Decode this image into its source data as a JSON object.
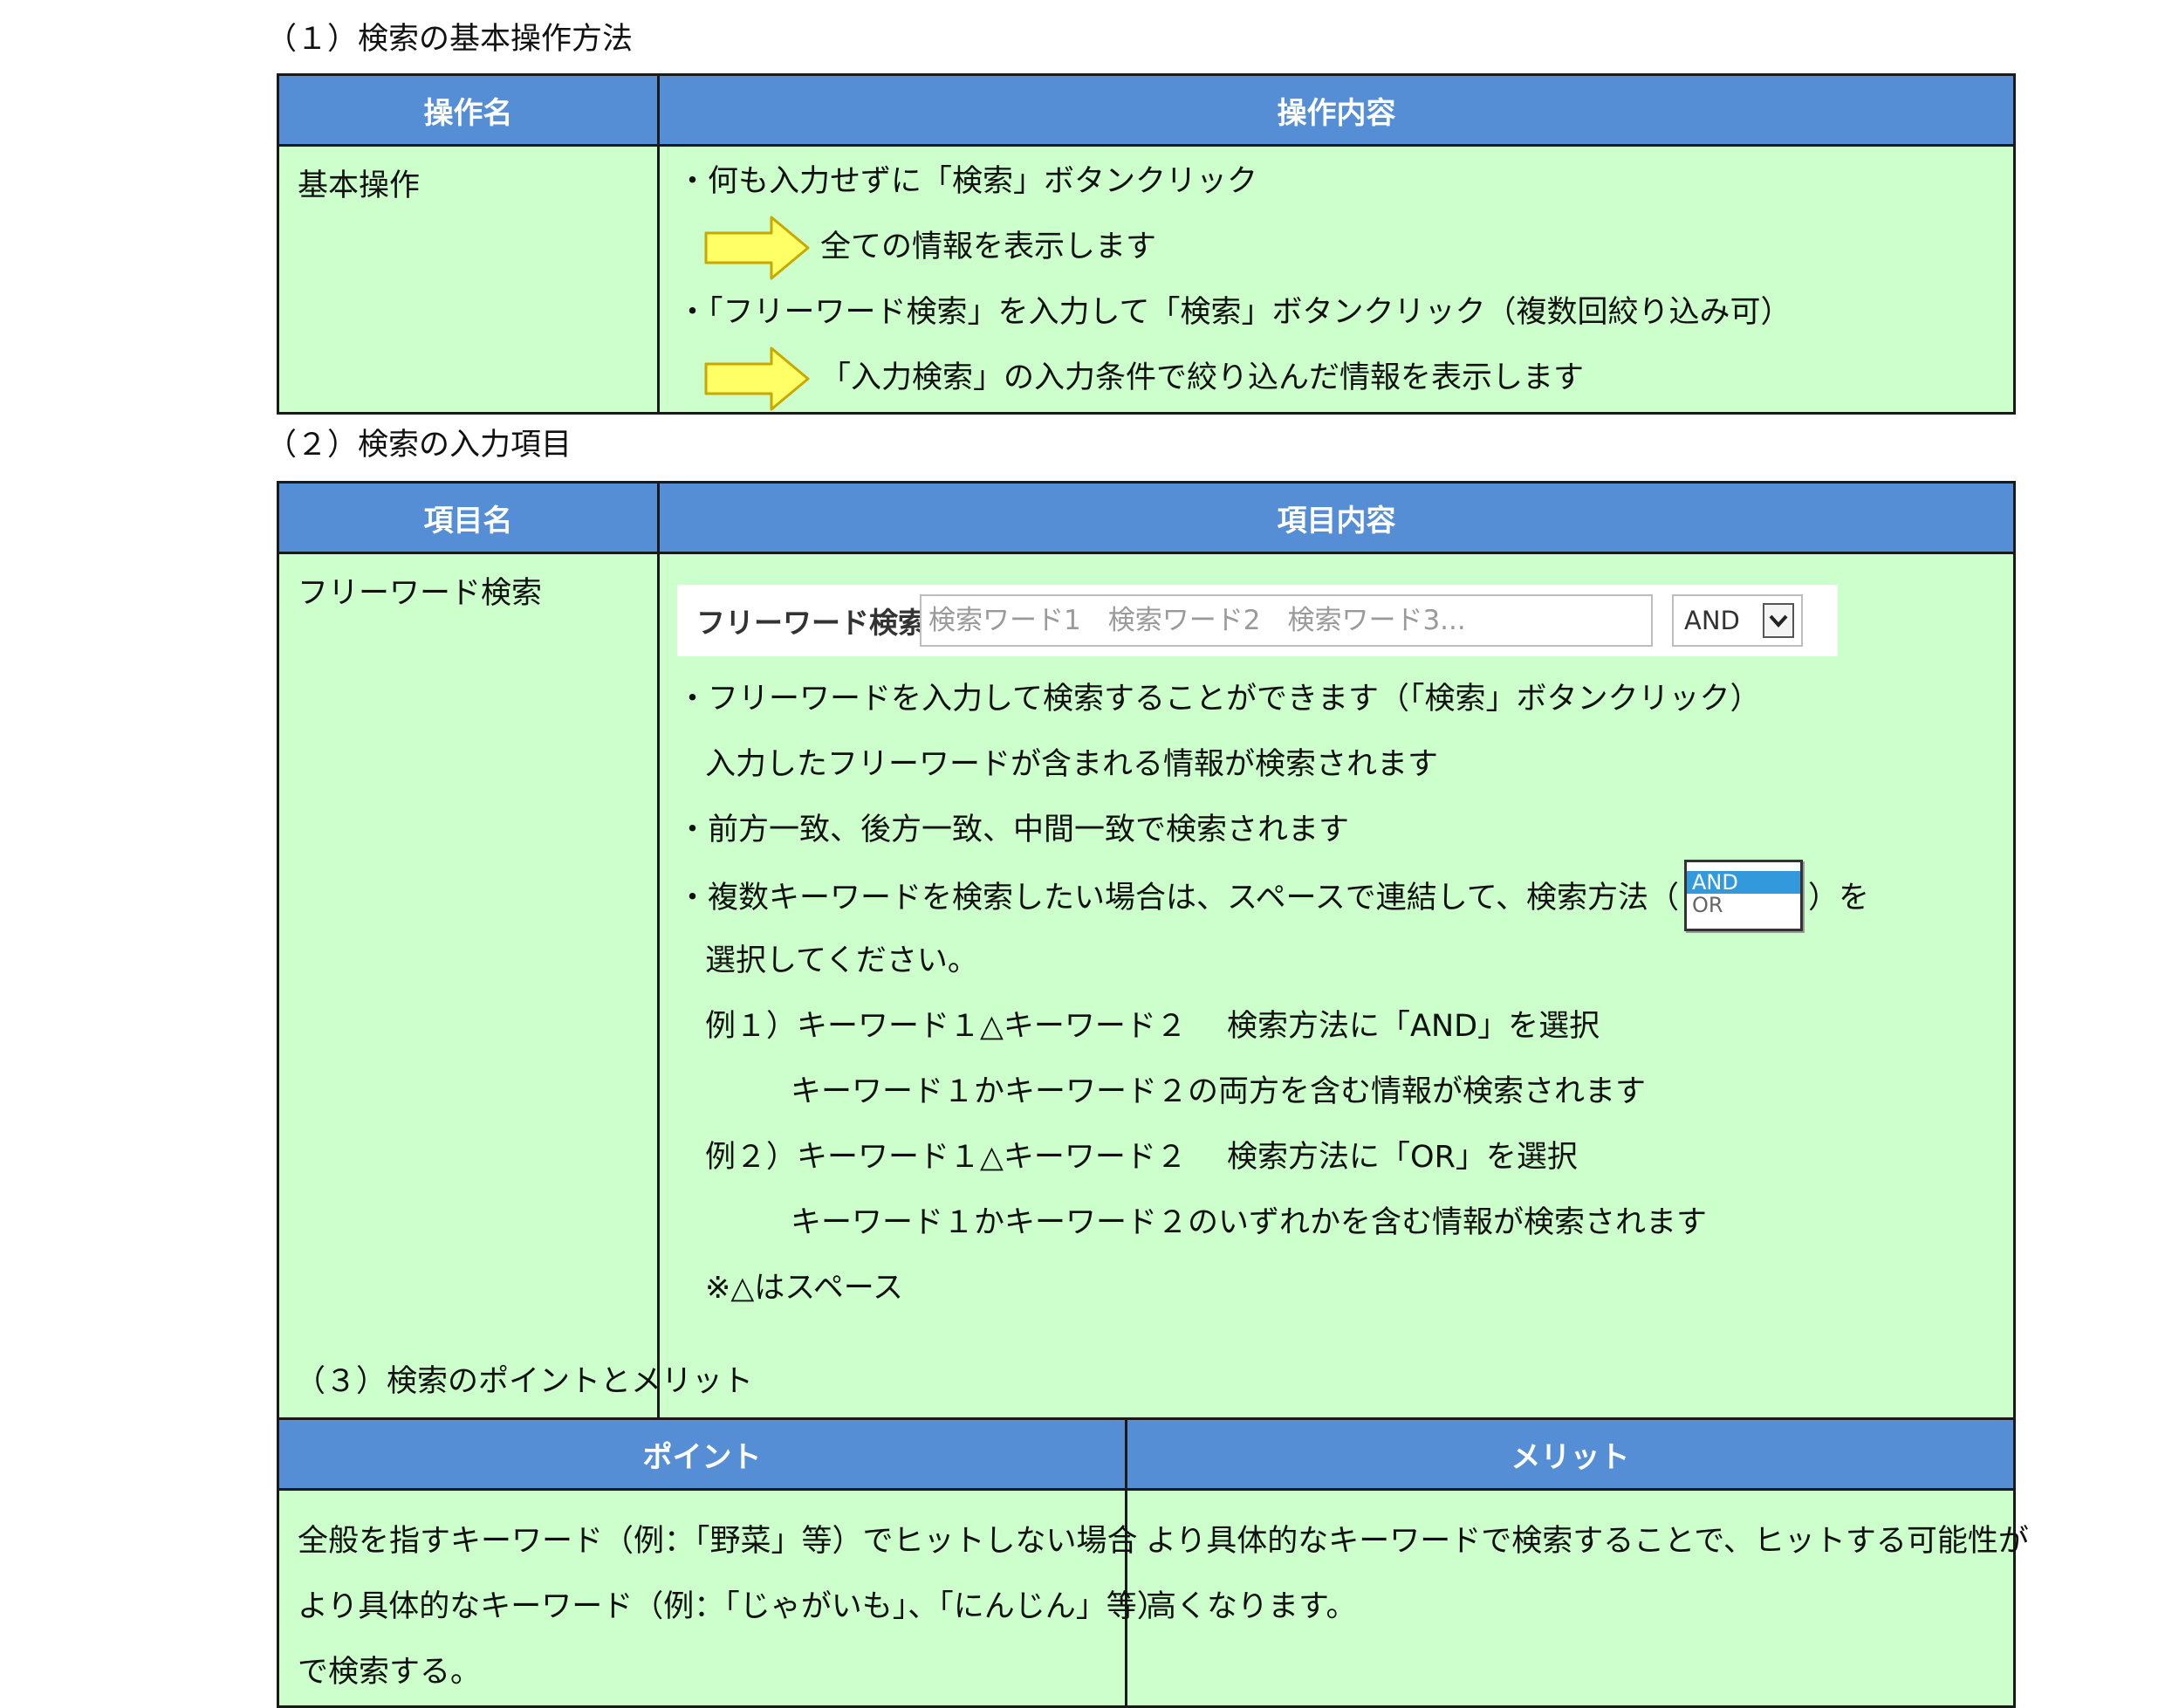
{
  "section1": {
    "title": "（１）検索の基本操作方法",
    "header_left": "操作名",
    "header_right": "操作内容",
    "row_name": "基本操作",
    "lines": [
      "・何も入力せずに「検索」ボタンクリック",
      "全ての情報を表示します",
      "・「フリーワード検索」を入力して「検索」ボタンクリック（複数回絞り込み可）",
      "「入力検索」の入力条件で絞り込んだ情報を表示します"
    ]
  },
  "section2": {
    "title": "（２）検索の入力項目",
    "header_left": "項目名",
    "header_right": "項目内容",
    "row_name": "フリーワード検索",
    "widget": {
      "label": "フリーワード検索",
      "placeholder": "検索ワード1　検索ワード2　検索ワード3...",
      "select_value": "AND"
    },
    "lines": [
      "・フリーワードを入力して検索することができます（「検索」ボタンクリック）",
      "入力したフリーワードが含まれる情報が検索されます",
      "・前方一致、後方一致、中間一致で検索されます",
      "・複数キーワードを検索したい場合は、スペースで連結して、検索方法（",
      "）を",
      "選択してください。",
      "例１）キーワード１△キーワード２　 検索方法に「AND」を選択",
      "キーワード１かキーワード２の両方を含む情報が検索されます",
      "例２）キーワード１△キーワード２　 検索方法に「OR」を選択",
      "キーワード１かキーワード２のいずれかを含む情報が検索されます",
      "※△はスペース"
    ],
    "mini_options": [
      "AND",
      "OR"
    ]
  },
  "section3": {
    "title": "（３）検索のポイントとメリット",
    "header_left": "ポイント",
    "header_right": "メリット",
    "point_lines": [
      "全般を指すキーワード（例：「野菜」等）でヒットしない場合",
      "より具体的なキーワード（例：「じゃがいも」、「にんじん」等）",
      "で検索する。"
    ],
    "merit_lines": [
      "より具体的なキーワードで検索することで、ヒットする可能性が",
      "高くなります。"
    ]
  },
  "colors": {
    "header_bg": "#558ed5",
    "cell_bg": "#ccffcc",
    "arrow_fill": "#ffff66",
    "arrow_stroke": "#c9a800",
    "select_highlight": "#3399dd"
  },
  "icons": {
    "arrow": "right-arrow-icon",
    "dropdown": "chevron-down-icon"
  }
}
